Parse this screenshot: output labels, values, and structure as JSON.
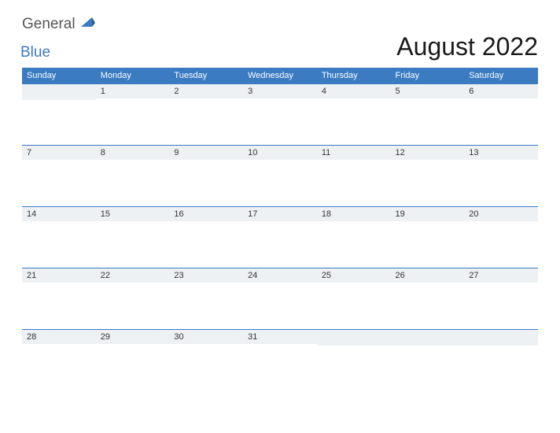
{
  "brand": {
    "word1": "General",
    "word2": "Blue"
  },
  "title": "August 2022",
  "days": [
    "Sunday",
    "Monday",
    "Tuesday",
    "Wednesday",
    "Thursday",
    "Friday",
    "Saturday"
  ],
  "weeks": [
    [
      "",
      "1",
      "2",
      "3",
      "4",
      "5",
      "6"
    ],
    [
      "7",
      "8",
      "9",
      "10",
      "11",
      "12",
      "13"
    ],
    [
      "14",
      "15",
      "16",
      "17",
      "18",
      "19",
      "20"
    ],
    [
      "21",
      "22",
      "23",
      "24",
      "25",
      "26",
      "27"
    ],
    [
      "28",
      "29",
      "30",
      "31",
      "",
      "",
      ""
    ]
  ]
}
